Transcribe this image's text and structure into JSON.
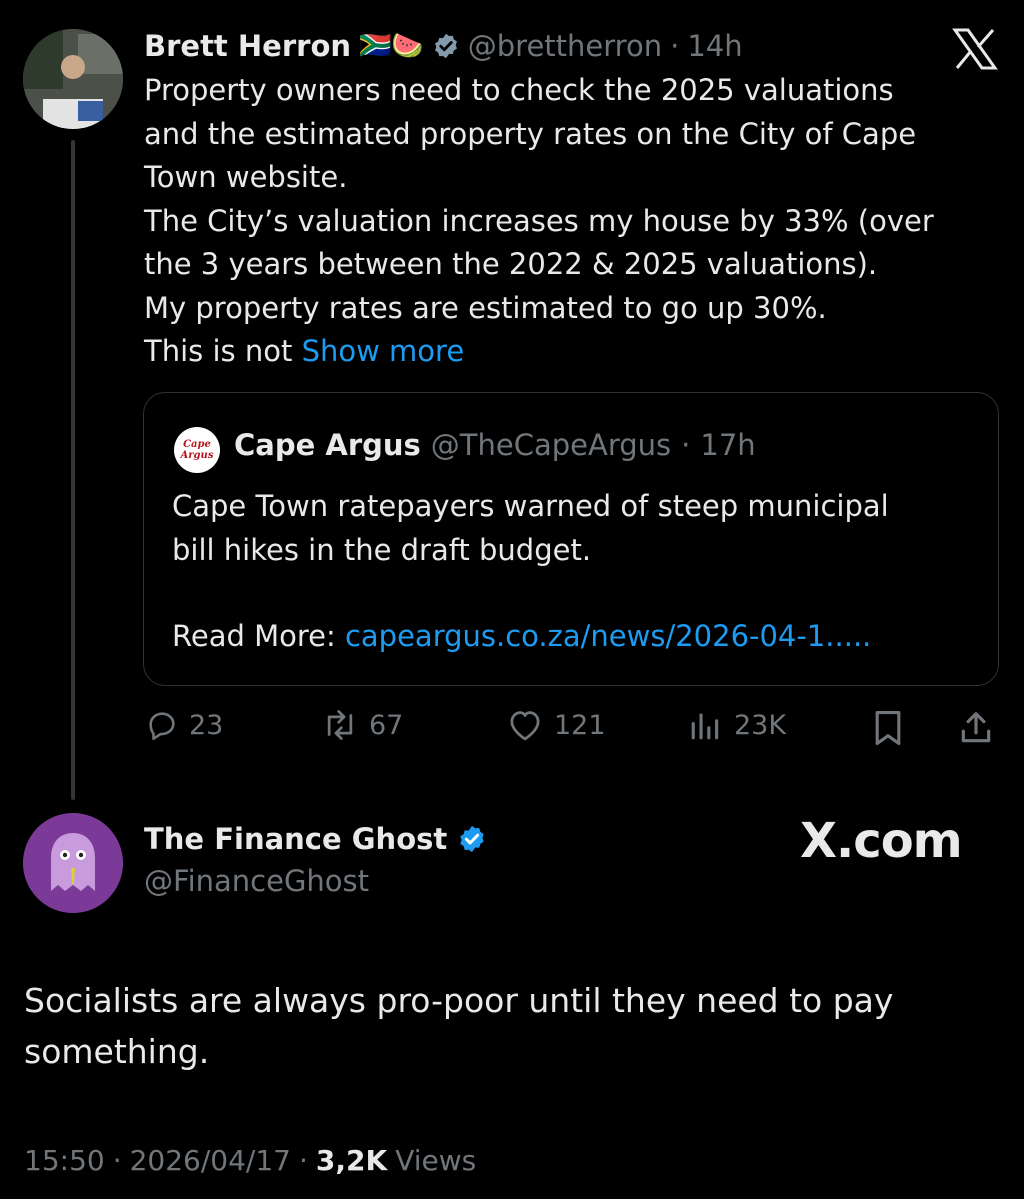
{
  "tweet": {
    "author_name": "Brett Herron",
    "author_handle": "@brettherron",
    "time": "14h",
    "emojis": "🇿🇦🍉",
    "text_lines": [
      "Property owners need to check the 2025 valuations",
      "and the estimated property rates on the City of Cape",
      "Town website.",
      "The City’s valuation increases my house by 33% (over",
      "the 3 years between the 2022 & 2025 valuations).",
      "My property rates are estimated to go up 30%."
    ],
    "last_line_text": "This is not",
    "show_more": "Show more",
    "quote": {
      "logo_text_1": "Cape",
      "logo_text_2": "Argus",
      "author_name": "Cape Argus",
      "author_handle": "@TheCapeArgus",
      "time": "17h",
      "text_lines": [
        "Cape Town ratepayers warned of steep municipal",
        "bill hikes in the draft budget."
      ],
      "read_more_label": "Read More:",
      "read_more_link": "capeargus.co.za/news/2026-04-1....."
    },
    "actions": {
      "replies": "23",
      "reposts": "67",
      "likes": "121",
      "views": "23K"
    }
  },
  "reply": {
    "author_name": "The Finance Ghost",
    "author_handle": "@FinanceGhost",
    "text_lines": [
      "Socialists are always pro-poor until they need to pay",
      "something."
    ],
    "time": "15:50",
    "date": "2026/04/17",
    "views_count": "3,2K",
    "views_label": "Views"
  },
  "watermark": "X.com",
  "colors": {
    "link": "#1d9bf0",
    "muted": "#71767b",
    "verified": "#1d9bf0",
    "background": "#000000"
  }
}
